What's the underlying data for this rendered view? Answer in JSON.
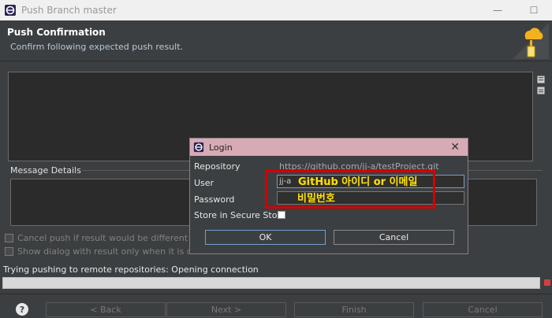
{
  "window": {
    "title": "Push Branch master",
    "minimize_glyph": "—",
    "maximize_glyph": "☐"
  },
  "header": {
    "title": "Push Confirmation",
    "subtitle": "Confirm following expected push result.",
    "icon": "push-cloud-icon"
  },
  "message_details": {
    "label": "Message Details"
  },
  "options": {
    "cancel_push_label": "Cancel push if result would be different than a",
    "show_dialog_label": "Show dialog with result only when it is differe"
  },
  "status": {
    "text": "Trying pushing to remote repositories: Opening connection"
  },
  "buttons": {
    "help": "?",
    "back": "< Back",
    "next": "Next >",
    "finish": "Finish",
    "cancel": "Cancel"
  },
  "login": {
    "title": "Login",
    "close_glyph": "✕",
    "repository_label": "Repository",
    "repository_value": "https://github.com/jj-a/testProject.git",
    "user_label": "User",
    "user_value": "jj-a",
    "password_label": "Password",
    "store_label": "Store in Secure Store",
    "store_checked": false,
    "ok": "OK",
    "cancel": "Cancel"
  },
  "annotation": {
    "user_hint": "GitHub 아이디 or 이메일",
    "password_hint": "비밀번호",
    "color": "#d40000"
  },
  "colors": {
    "dialog_title_bg": "#d7abb5",
    "background": "#3c3f41",
    "hint_text": "#ffe300"
  }
}
